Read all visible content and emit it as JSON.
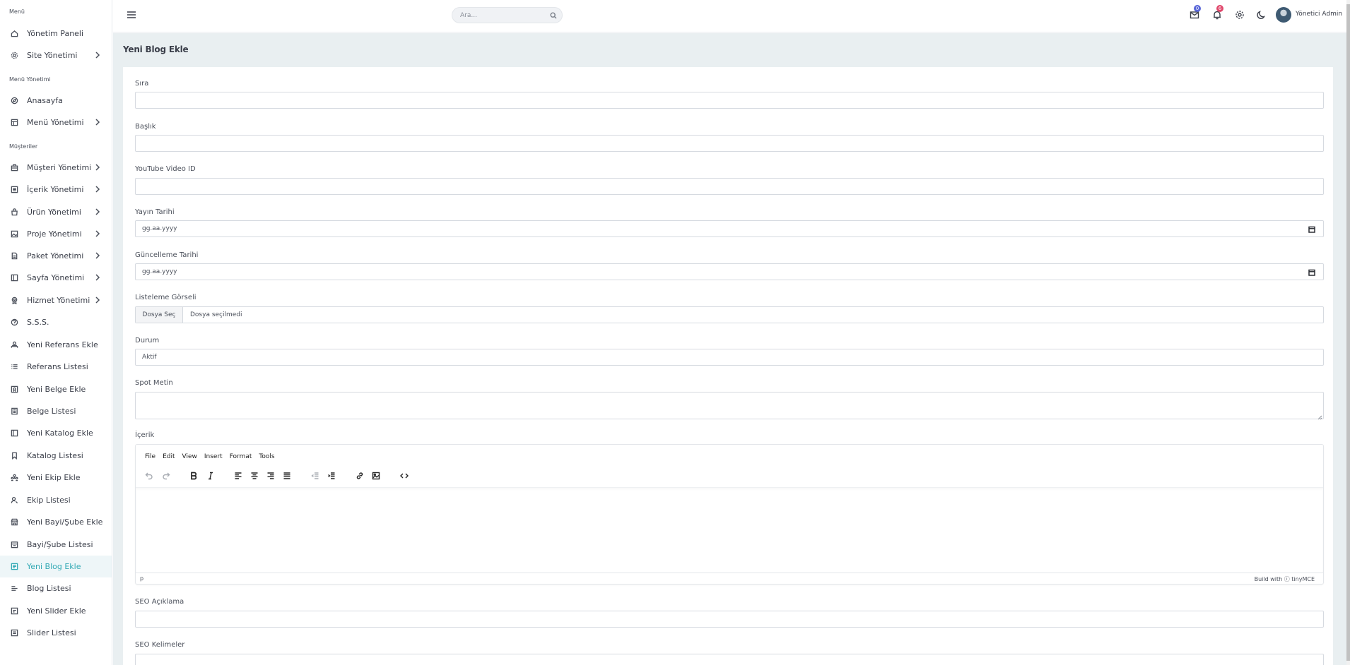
{
  "sidebar": {
    "sections": [
      {
        "heading": "Menü"
      },
      {
        "heading": "Menü Yönetimi"
      },
      {
        "heading": "Müşteriler"
      }
    ],
    "items": [
      {
        "label": "Yönetim Paneli",
        "icon": "home-icon"
      },
      {
        "label": "Site Yönetimi",
        "icon": "gear-icon",
        "submenu": true
      },
      {
        "label": "Anasayfa",
        "icon": "compass-icon"
      },
      {
        "label": "Menü Yönetimi",
        "icon": "layout-icon",
        "submenu": true
      },
      {
        "label": "Müşteri Yönetimi",
        "icon": "briefcase-icon",
        "submenu": true
      },
      {
        "label": "İçerik Yönetimi",
        "icon": "file-list-icon",
        "submenu": true
      },
      {
        "label": "Ürün Yönetimi",
        "icon": "bag-icon",
        "submenu": true
      },
      {
        "label": "Proje Yönetimi",
        "icon": "image-icon",
        "submenu": true
      },
      {
        "label": "Paket Yönetimi",
        "icon": "document-icon",
        "submenu": true
      },
      {
        "label": "Sayfa Yönetimi",
        "icon": "panel-icon",
        "submenu": true
      },
      {
        "label": "Hizmet Yönetimi",
        "icon": "badge-icon",
        "submenu": true
      },
      {
        "label": "S.S.S.",
        "icon": "help-icon"
      },
      {
        "label": "Yeni Referans Ekle",
        "icon": "users-icon"
      },
      {
        "label": "Referans Listesi",
        "icon": "list-icon"
      },
      {
        "label": "Yeni Belge Ekle",
        "icon": "certificate-icon"
      },
      {
        "label": "Belge Listesi",
        "icon": "doc-list-icon"
      },
      {
        "label": "Yeni Katalog Ekle",
        "icon": "book-icon"
      },
      {
        "label": "Katalog Listesi",
        "icon": "bookmark-icon"
      },
      {
        "label": "Yeni Ekip Ekle",
        "icon": "team-icon"
      },
      {
        "label": "Ekip Listesi",
        "icon": "user-search-icon"
      },
      {
        "label": "Yeni Bayi/Şube Ekle",
        "icon": "store-icon"
      },
      {
        "label": "Bayi/Şube Listesi",
        "icon": "building-icon"
      },
      {
        "label": "Yeni Blog Ekle",
        "icon": "blog-icon",
        "active": true
      },
      {
        "label": "Blog Listesi",
        "icon": "lines-icon"
      },
      {
        "label": "Yeni Slider Ekle",
        "icon": "slider-icon"
      },
      {
        "label": "Slider Listesi",
        "icon": "slider-list-icon"
      }
    ]
  },
  "topbar": {
    "search_placeholder": "Ara...",
    "mail_badge": "0",
    "notification_badge": "6",
    "user_name": "Yönetici Admin"
  },
  "page": {
    "title": "Yeni Blog Ekle"
  },
  "form": {
    "sira_label": "Sıra",
    "baslik_label": "Başlık",
    "youtube_label": "YouTube Video ID",
    "yayin_label": "Yayın Tarihi",
    "yayin_value": "gg.aa.yyyy",
    "guncelleme_label": "Güncelleme Tarihi",
    "guncelleme_value": "gg.aa.yyyy",
    "gorsel_label": "Listeleme Görseli",
    "file_button": "Dosya Seç",
    "file_status": "Dosya seçilmedi",
    "durum_label": "Durum",
    "durum_value": "Aktif",
    "spot_label": "Spot Metin",
    "icerik_label": "İçerik",
    "seo_aciklama_label": "SEO Açıklama",
    "seo_kelimeler_label": "SEO Kelimeler"
  },
  "editor": {
    "menu": [
      "File",
      "Edit",
      "View",
      "Insert",
      "Format",
      "Tools"
    ],
    "path": "p",
    "brand": "Build with ⓘ tinyMCE"
  }
}
